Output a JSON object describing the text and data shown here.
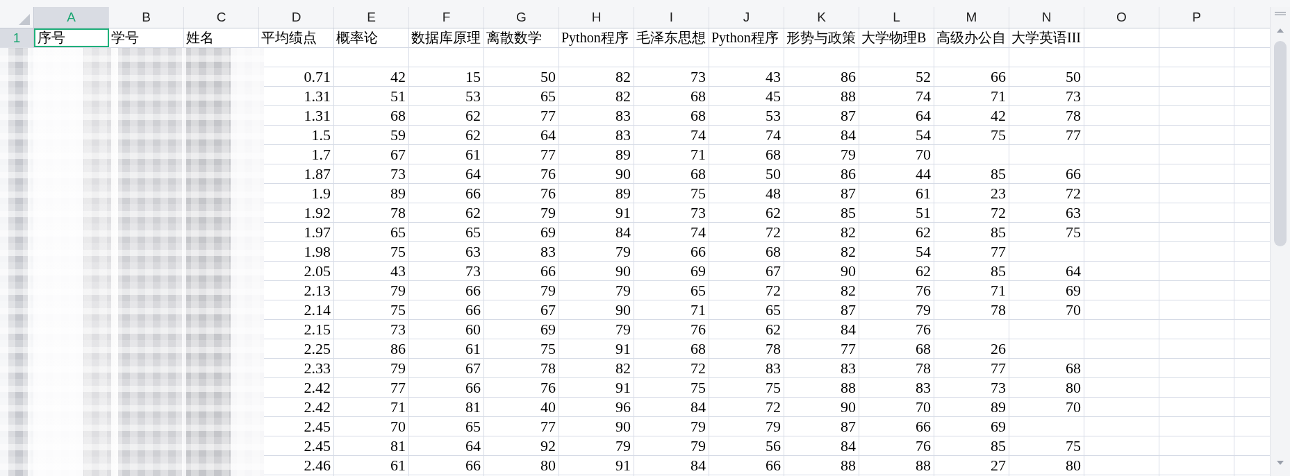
{
  "column_headers": [
    {
      "label": "A",
      "selected": true
    },
    {
      "label": "B",
      "selected": false
    },
    {
      "label": "C",
      "selected": false
    },
    {
      "label": "D",
      "selected": false
    },
    {
      "label": "E",
      "selected": false
    },
    {
      "label": "F",
      "selected": false
    },
    {
      "label": "G",
      "selected": false
    },
    {
      "label": "H",
      "selected": false
    },
    {
      "label": "I",
      "selected": false
    },
    {
      "label": "J",
      "selected": false
    },
    {
      "label": "K",
      "selected": false
    },
    {
      "label": "L",
      "selected": false
    },
    {
      "label": "M",
      "selected": false
    },
    {
      "label": "N",
      "selected": false
    },
    {
      "label": "O",
      "selected": false
    },
    {
      "label": "P",
      "selected": false
    }
  ],
  "header_row": {
    "row_number": {
      "label": "1",
      "selected": true
    },
    "cells": [
      {
        "text": "序号",
        "selected": true
      },
      {
        "text": "学号",
        "selected": false
      },
      {
        "text": "姓名",
        "selected": false
      },
      {
        "text": "平均绩点",
        "selected": false
      },
      {
        "text": "概率论",
        "selected": false
      },
      {
        "text": "数据库原理",
        "selected": false
      },
      {
        "text": "离散数学",
        "selected": false
      },
      {
        "text": "Python程序",
        "selected": false
      },
      {
        "text": "毛泽东思想",
        "selected": false
      },
      {
        "text": "Python程序",
        "selected": false
      },
      {
        "text": "形势与政策",
        "selected": false
      },
      {
        "text": "大学物理B",
        "selected": false
      },
      {
        "text": "高级办公自",
        "selected": false
      },
      {
        "text": "大学英语III",
        "selected": false
      }
    ]
  },
  "data_rows": [
    {
      "cells": [
        null,
        null,
        null,
        null,
        null,
        null,
        null,
        null,
        null,
        null,
        null
      ]
    },
    {
      "cells": [
        "0.71",
        "42",
        "15",
        "50",
        "82",
        "73",
        "43",
        "86",
        "52",
        "66",
        "50"
      ]
    },
    {
      "cells": [
        "1.31",
        "51",
        "53",
        "65",
        "82",
        "68",
        "45",
        "88",
        "74",
        "71",
        "73"
      ]
    },
    {
      "cells": [
        "1.31",
        "68",
        "62",
        "77",
        "83",
        "68",
        "53",
        "87",
        "64",
        "42",
        "78"
      ]
    },
    {
      "cells": [
        "1.5",
        "59",
        "62",
        "64",
        "83",
        "74",
        "74",
        "84",
        "54",
        "75",
        "77"
      ]
    },
    {
      "cells": [
        "1.7",
        "67",
        "61",
        "77",
        "89",
        "71",
        "68",
        "79",
        "70",
        null,
        null
      ]
    },
    {
      "cells": [
        "1.87",
        "73",
        "64",
        "76",
        "90",
        "68",
        "50",
        "86",
        "44",
        "85",
        "66"
      ]
    },
    {
      "cells": [
        "1.9",
        "89",
        "66",
        "76",
        "89",
        "75",
        "48",
        "87",
        "61",
        "23",
        "72"
      ]
    },
    {
      "cells": [
        "1.92",
        "78",
        "62",
        "79",
        "91",
        "73",
        "62",
        "85",
        "51",
        "72",
        "63"
      ]
    },
    {
      "cells": [
        "1.97",
        "65",
        "65",
        "69",
        "84",
        "74",
        "72",
        "82",
        "62",
        "85",
        "75"
      ]
    },
    {
      "cells": [
        "1.98",
        "75",
        "63",
        "83",
        "79",
        "66",
        "68",
        "82",
        "54",
        "77",
        null
      ]
    },
    {
      "cells": [
        "2.05",
        "43",
        "73",
        "66",
        "90",
        "69",
        "67",
        "90",
        "62",
        "85",
        "64"
      ]
    },
    {
      "cells": [
        "2.13",
        "79",
        "66",
        "79",
        "79",
        "65",
        "72",
        "82",
        "76",
        "71",
        "69"
      ]
    },
    {
      "cells": [
        "2.14",
        "75",
        "66",
        "67",
        "90",
        "71",
        "65",
        "87",
        "79",
        "78",
        "70"
      ]
    },
    {
      "cells": [
        "2.15",
        "73",
        "60",
        "69",
        "79",
        "76",
        "62",
        "84",
        "76",
        null,
        null
      ]
    },
    {
      "cells": [
        "2.25",
        "86",
        "61",
        "75",
        "91",
        "68",
        "78",
        "77",
        "68",
        "26",
        null
      ]
    },
    {
      "cells": [
        "2.33",
        "79",
        "67",
        "78",
        "82",
        "72",
        "83",
        "83",
        "78",
        "77",
        "68"
      ]
    },
    {
      "cells": [
        "2.42",
        "77",
        "66",
        "76",
        "91",
        "75",
        "75",
        "88",
        "83",
        "73",
        "80"
      ]
    },
    {
      "cells": [
        "2.42",
        "71",
        "81",
        "40",
        "96",
        "84",
        "72",
        "90",
        "70",
        "89",
        "70"
      ]
    },
    {
      "cells": [
        "2.45",
        "70",
        "65",
        "77",
        "90",
        "79",
        "79",
        "87",
        "66",
        "69",
        null
      ]
    },
    {
      "cells": [
        "2.45",
        "81",
        "64",
        "92",
        "79",
        "79",
        "56",
        "84",
        "76",
        "85",
        "75"
      ]
    },
    {
      "cells": [
        "2.46",
        "61",
        "66",
        "80",
        "91",
        "84",
        "66",
        "88",
        "88",
        "27",
        "80"
      ]
    }
  ]
}
